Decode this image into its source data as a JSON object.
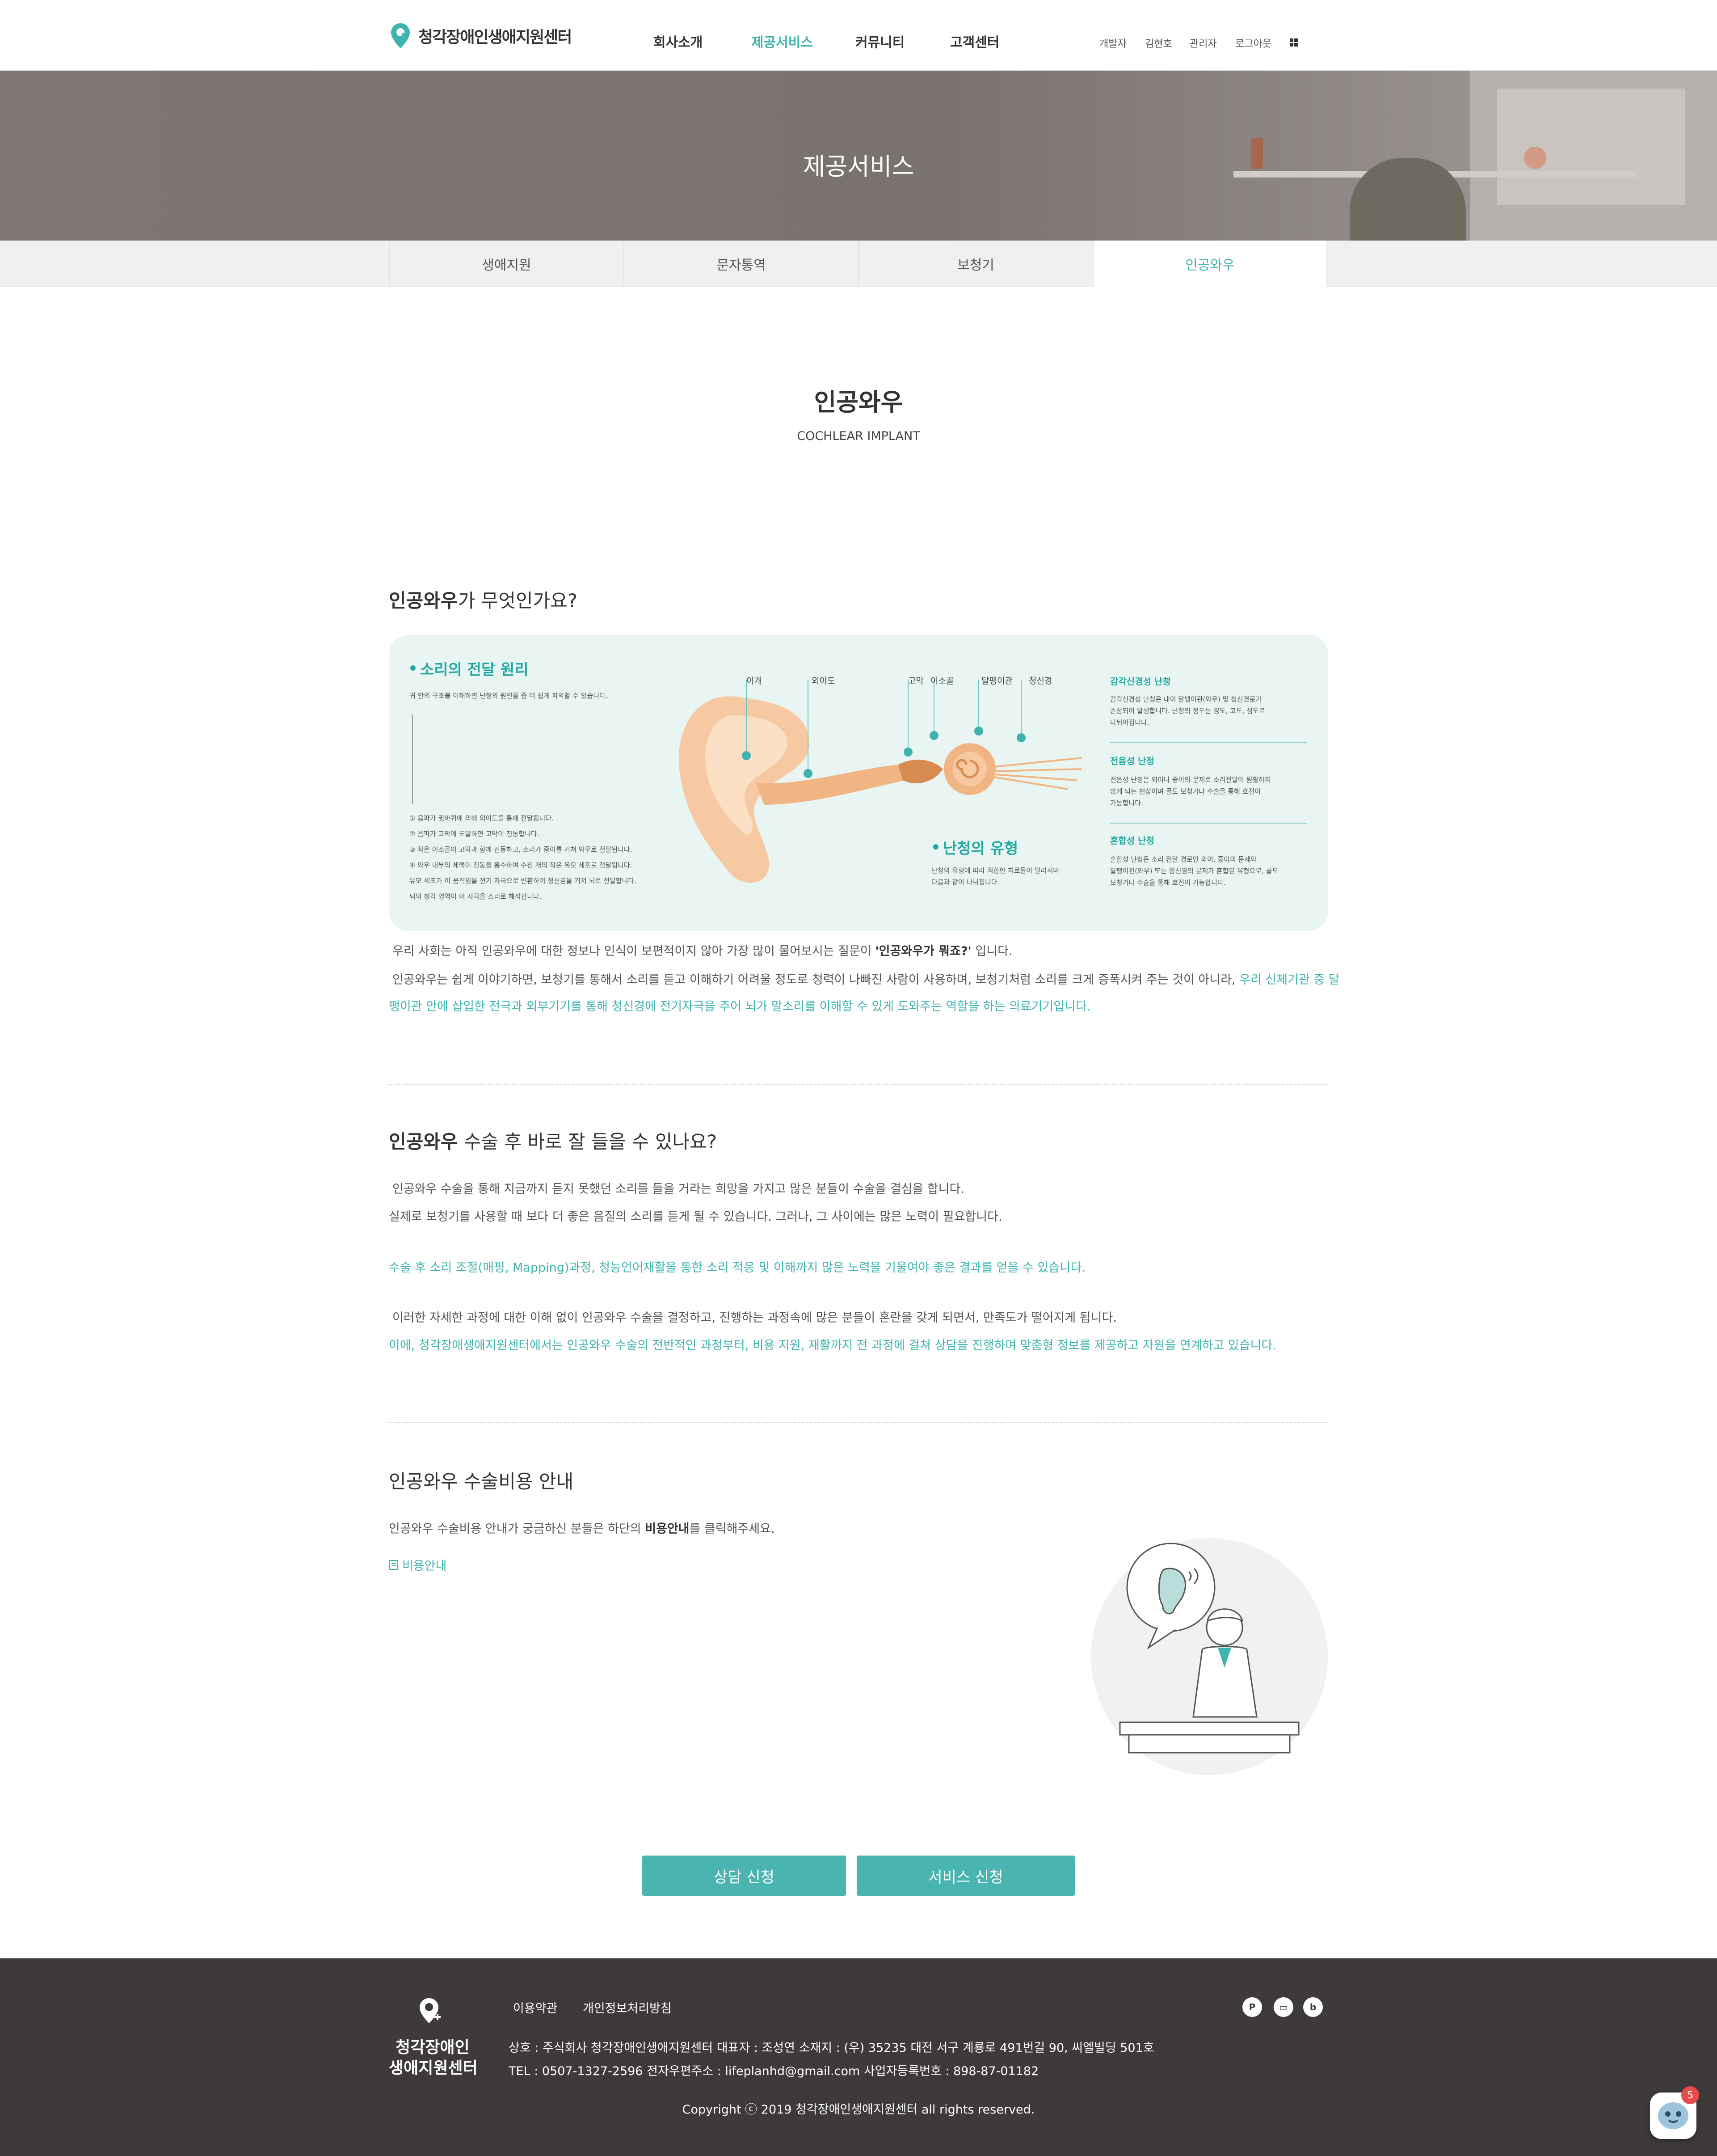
{
  "header": {
    "logo_text": "청각장애인생애지원센터",
    "nav": [
      "회사소개",
      "제공서비스",
      "커뮤니티",
      "고객센터"
    ],
    "util": [
      "개발자",
      "김현호",
      "관리자",
      "로그아웃"
    ]
  },
  "hero": {
    "title": "제공서비스"
  },
  "tabs": [
    "생애지원",
    "문자통역",
    "보청기",
    "인공와우"
  ],
  "page": {
    "title": "인공와우",
    "subtitle": "COCHLEAR IMPLANT"
  },
  "section1": {
    "heading_bold": "인공와우",
    "heading_rest": "가 무엇인가요?",
    "p1_a": "우리 사회는 아직 인공와우에 대한 정보나 인식이 보편적이지 않아 가장 많이 물어보시는 질문이 ",
    "p1_b": "'인공와우가 뭐죠?'",
    "p1_c": " 입니다.",
    "p2_a": "인공와우는 쉽게 이야기하면, 보청기를 통해서 소리를 듣고 이해하기 어려울 정도로 청력이 나빠진 사람이 사용하며, 보청기처럼 소리를 크게 증폭시켜 주는 것이 아니라, ",
    "p2_b": "우리 신체기관 중 달",
    "p3": "팽이관 안에 삽입한 전극과 외부기기를 통해 청신경에 전기자극을 주어 뇌가 말소리를 이해할 수 있게 도와주는 역할을 하는 의료기기입니다."
  },
  "diagram": {
    "title1": "소리의 전달 원리",
    "sub1": "귀 안의 구조를 이해하면 난청의 원인을 좀 더 쉽게 파악할 수 있습니다.",
    "steps": [
      "① 음파가 귓바퀴에 의해 외이도를 통해 전달됩니다.",
      "② 음파가 고막에 도달하면 고막이 진동합니다.",
      "③ 작은 이소골이 고막과 함께 진동하고, 소리가 중이를 거쳐 와우로 전달됩니다.",
      "④ 와우 내부의 체액이 진동을 흡수하여 수천 개의 작은 유모 세포로 전달됩니다.",
      "유모 세포가 이 움직임을 전기 자극으로 변환하여 청신경을 거쳐 뇌로 전달합니다.",
      "뇌의 청각 영역이 이 자극을 소리로 해석합니다."
    ],
    "labels": [
      "이개",
      "외이도",
      "고막",
      "이소골",
      "달팽이관",
      "청신경"
    ],
    "title2": "난청의 유형",
    "sub2": [
      "난청의 유형에 따라 적합한 치료들이 달라지며",
      "다음과 같이 나뉘집니다."
    ],
    "types": [
      {
        "name": "감각신경성 난청",
        "lines": [
          "감각신경성 난청은 내이 달팽이관(와우) 및 청신경로가",
          "손상되어 발생합니다. 난청의 정도는 경도, 고도, 심도로",
          "나뉘어집니다."
        ]
      },
      {
        "name": "전음성 난청",
        "lines": [
          "전음성 난청은 외이나 중이의 문제로 소리전달이 원활하지",
          "않게 되는 현상이며 골도 보청기나 수술을 통해 호전이",
          "가능합니다."
        ]
      },
      {
        "name": "혼합성 난청",
        "lines": [
          "혼합성 난청은 소리 전달 경로인 외이, 중이의 문제와",
          "달팽이관(와우) 또는 청신경의 문제가 혼합된 유형으로, 골도",
          "보청기나 수술을 통해 호전이 가능합니다."
        ]
      }
    ]
  },
  "section2": {
    "heading_bold": "인공와우",
    "heading_rest": " 수술 후 바로 잘 들을 수 있나요?",
    "p1": "인공와우 수술을 통해 지금까지 듣지 못했던 소리를 들을 거라는 희망을 가지고 많은 분들이 수술을 결심을 합니다.",
    "p2": "실제로 보청기를 사용할 때 보다 더 좋은 음질의 소리를 듣게 될 수 있습니다. 그러나, 그 사이에는 많은 노력이 필요합니다.",
    "p3": "수술 후 소리 조절(매핑, Mapping)과정, 청능언어재활을 통한 소리 적응 및 이해까지 많은 노력을 기울여야 좋은 결과를 얻을 수 있습니다.",
    "p4": "이러한 자세한 과정에 대한 이해 없이 인공와우 수술을 결정하고, 진행하는 과정속에 많은 분들이 혼란을 갖게 되면서, 만족도가 떨어지게 됩니다.",
    "p5": "이에, 청각장애생애지원센터에서는 인공와우 수술의 전반적인 과정부터, 비용 지원, 재활까지 전 과정에 걸쳐 상담을 진행하며 맞춤형 정보를 제공하고 자원을 연계하고 있습니다."
  },
  "section3": {
    "heading": "인공와우 수술비용 안내",
    "p1_a": "인공와우 수술비용 안내가 궁금하신 분들은 하단의 ",
    "p1_b": "비용안내",
    "p1_c": "를 클릭해주세요.",
    "link": "비용안내"
  },
  "buttons": {
    "consult": "상담 신청",
    "service": "서비스 신청"
  },
  "footer": {
    "logo_line1": "청각장애인",
    "logo_line2": "생애지원센터",
    "links": [
      "이용약관",
      "개인정보처리방침"
    ],
    "info1": "상호 : 주식회사 청각장애인생애지원센터    대표자 : 조성연    소재지 : (우) 35235 대전 서구 계룡로 491번길 90, 씨엘빌딩 501호",
    "info2": "TEL : 0507-1327-2596    전자우편주소 : lifeplanhd@gmail.com    사업자등록번호 : 898-87-01182",
    "copyright": "Copyright ⓒ 2019 청각장애인생애지원센터 all rights reserved.",
    "sns": [
      "P",
      "▭",
      "b"
    ]
  },
  "chat": {
    "badge": "5"
  },
  "colors": {
    "accent": "#3fb3ad",
    "button": "#4ab5b0",
    "footer": "#3e3a39"
  }
}
